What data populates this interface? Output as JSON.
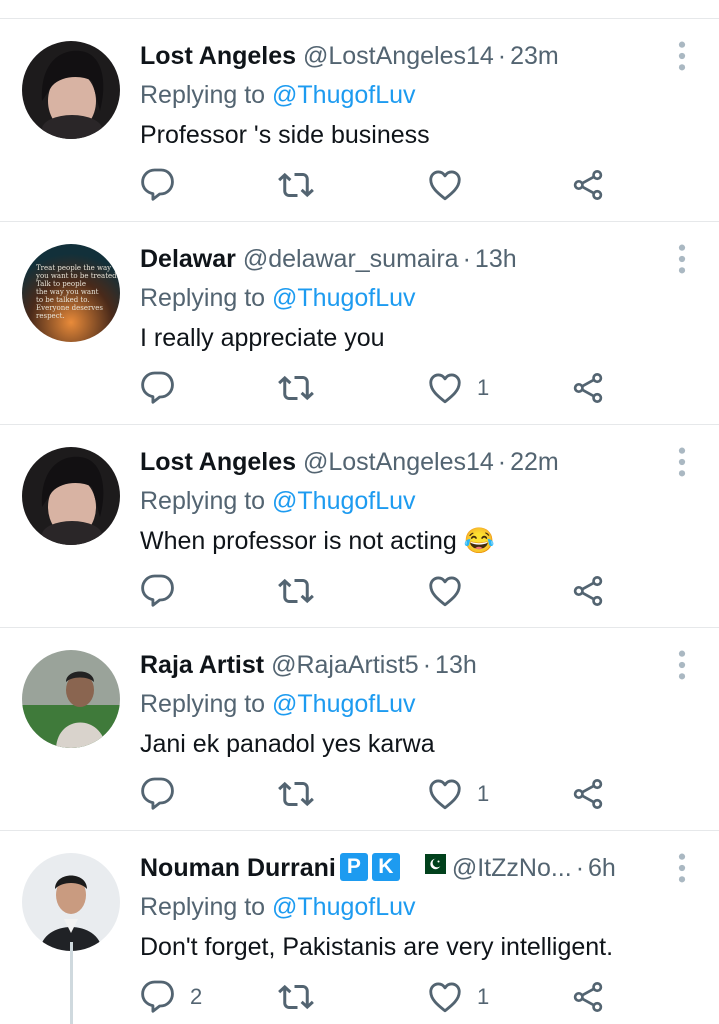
{
  "tweets": [
    {
      "name": "Lost Angeles",
      "handle": "@LostAngeles14",
      "sep": "·",
      "time": "23m",
      "replying_prefix": "Replying to ",
      "replying_to": "@ThugofLuv",
      "text": "Professor 's side business",
      "replies": "",
      "retweets": "",
      "likes": ""
    },
    {
      "name": "Delawar",
      "handle": "@delawar_sumaira",
      "sep": "·",
      "time": "13h",
      "replying_prefix": "Replying to ",
      "replying_to": "@ThugofLuv",
      "text": "I really appreciate you",
      "replies": "",
      "retweets": "",
      "likes": "1",
      "avatar_text": [
        "Treat people the way",
        "you want to be treated.",
        "Talk to people",
        "the way you want",
        "to be talked to.",
        "Everyone deserves",
        "respect."
      ]
    },
    {
      "name": "Lost Angeles",
      "handle": "@LostAngeles14",
      "sep": "·",
      "time": "22m",
      "replying_prefix": "Replying to ",
      "replying_to": "@ThugofLuv",
      "text": "When professor is not acting 😂",
      "replies": "",
      "retweets": "",
      "likes": ""
    },
    {
      "name": "Raja Artist",
      "handle": "@RajaArtist5",
      "sep": "·",
      "time": "13h",
      "replying_prefix": "Replying to ",
      "replying_to": "@ThugofLuv",
      "text": "Jani ek panadol yes karwa",
      "replies": "",
      "retweets": "",
      "likes": "1"
    },
    {
      "name": "Nouman Durrani",
      "badge1": "P",
      "badge2": "K",
      "handle": "@ItZzNo...",
      "sep": "·",
      "time": "6h",
      "replying_prefix": "Replying to ",
      "replying_to": "@ThugofLuv",
      "text": "Don't forget, Pakistanis are very intelligent.",
      "replies": "2",
      "retweets": "",
      "likes": "1"
    }
  ],
  "icons": {
    "reply": "reply-icon",
    "retweet": "retweet-icon",
    "like": "heart-icon",
    "share": "share-icon",
    "more": "more-vertical-icon"
  },
  "colors": {
    "link": "#1d9bf0",
    "muted": "#536471",
    "text": "#0f1419",
    "divider": "#e6e8ea"
  }
}
